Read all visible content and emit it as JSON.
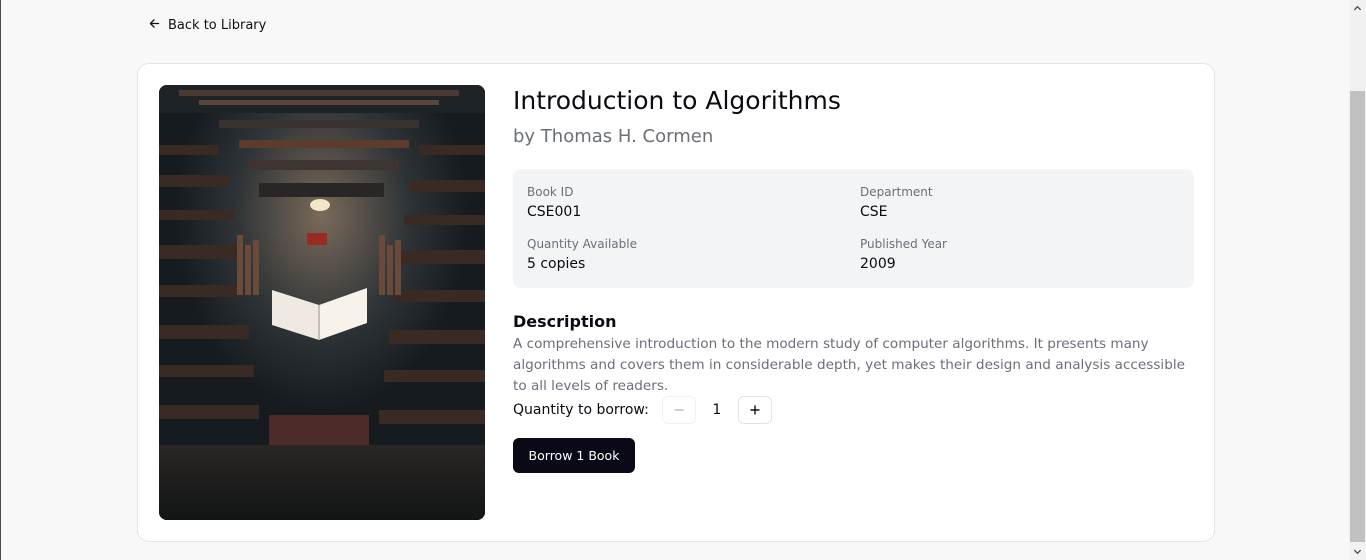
{
  "nav": {
    "back_label": "Back to Library",
    "back_icon": "arrow-left-icon"
  },
  "book": {
    "title": "Introduction to Algorithms",
    "author": "by Thomas H. Cormen",
    "cover_alt": "library book cover image",
    "details": {
      "book_id_label": "Book ID",
      "book_id": "CSE001",
      "department_label": "Department",
      "department": "CSE",
      "quantity_label": "Quantity Available",
      "quantity": "5 copies",
      "year_label": "Published Year",
      "year": "2009"
    },
    "description_heading": "Description",
    "description": "A comprehensive introduction to the modern study of computer algorithms. It presents many algorithms and covers them in considerable depth, yet makes their design and analysis accessible to all levels of readers."
  },
  "borrow": {
    "quantity_label": "Quantity to borrow:",
    "quantity_value": "1",
    "decrement_icon": "minus-icon",
    "increment_icon": "plus-icon",
    "decrement_disabled": true,
    "button_label": "Borrow 1 Book"
  },
  "colors": {
    "primary": "#0a0a16",
    "muted_text": "#6b6f7a",
    "info_bg": "#f3f4f6",
    "page_bg": "#f8f8f8"
  }
}
